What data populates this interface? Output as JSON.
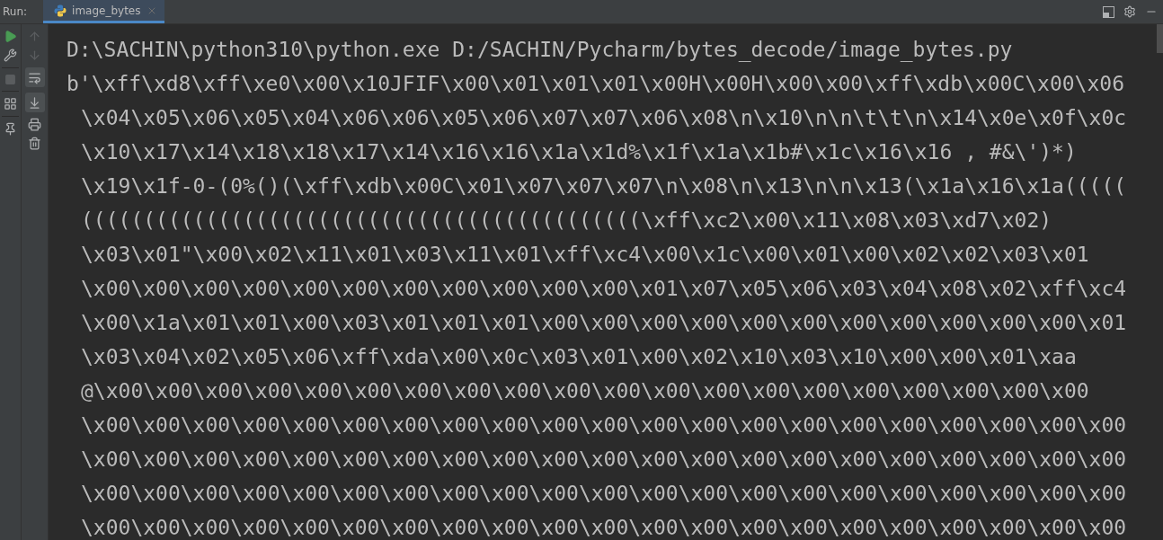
{
  "toolwindow": {
    "label": "Run:",
    "tab": {
      "title": "image_bytes",
      "selected": true
    }
  },
  "console": {
    "lines": [
      {
        "text": "D:\\SACHIN\\python310\\python.exe D:/SACHIN/Pycharm/bytes_decode/image_bytes.py",
        "continuation": false
      },
      {
        "text": "b'\\xff\\xd8\\xff\\xe0\\x00\\x10JFIF\\x00\\x01\\x01\\x01\\x00H\\x00H\\x00\\x00\\xff\\xdb\\x00C\\x00\\x06",
        "continuation": false
      },
      {
        "text": "\\x04\\x05\\x06\\x05\\x04\\x06\\x06\\x05\\x06\\x07\\x07\\x06\\x08\\n\\x10\\n\\n\\t\\t\\n\\x14\\x0e\\x0f\\x0c",
        "continuation": true
      },
      {
        "text": "\\x10\\x17\\x14\\x18\\x18\\x17\\x14\\x16\\x16\\x1a\\x1d%\\x1f\\x1a\\x1b#\\x1c\\x16\\x16 , #&\\')*)",
        "continuation": true
      },
      {
        "text": "\\x19\\x1f-0-(0%()(\\xff\\xdb\\x00C\\x01\\x07\\x07\\x07\\n\\x08\\n\\x13\\n\\n\\x13(\\x1a\\x16\\x1a(((((",
        "continuation": true
      },
      {
        "text": "(((((((((((((((((((((((((((((((((((((((((((((\\xff\\xc2\\x00\\x11\\x08\\x03\\xd7\\x02)",
        "continuation": true
      },
      {
        "text": "\\x03\\x01\"\\x00\\x02\\x11\\x01\\x03\\x11\\x01\\xff\\xc4\\x00\\x1c\\x00\\x01\\x00\\x02\\x02\\x03\\x01",
        "continuation": true
      },
      {
        "text": "\\x00\\x00\\x00\\x00\\x00\\x00\\x00\\x00\\x00\\x00\\x00\\x01\\x07\\x05\\x06\\x03\\x04\\x08\\x02\\xff\\xc4",
        "continuation": true
      },
      {
        "text": "\\x00\\x1a\\x01\\x01\\x00\\x03\\x01\\x01\\x01\\x00\\x00\\x00\\x00\\x00\\x00\\x00\\x00\\x00\\x00\\x00\\x01",
        "continuation": true
      },
      {
        "text": "\\x03\\x04\\x02\\x05\\x06\\xff\\xda\\x00\\x0c\\x03\\x01\\x00\\x02\\x10\\x03\\x10\\x00\\x00\\x01\\xaa",
        "continuation": true
      },
      {
        "text": "@\\x00\\x00\\x00\\x00\\x00\\x00\\x00\\x00\\x00\\x00\\x00\\x00\\x00\\x00\\x00\\x00\\x00\\x00\\x00\\x00",
        "continuation": true
      },
      {
        "text": "\\x00\\x00\\x00\\x00\\x00\\x00\\x00\\x00\\x00\\x00\\x00\\x00\\x00\\x00\\x00\\x00\\x00\\x00\\x00\\x00\\x00",
        "continuation": true
      },
      {
        "text": "\\x00\\x00\\x00\\x00\\x00\\x00\\x00\\x00\\x00\\x00\\x00\\x00\\x00\\x00\\x00\\x00\\x00\\x00\\x00\\x00\\x00",
        "continuation": true
      },
      {
        "text": "\\x00\\x00\\x00\\x00\\x00\\x00\\x00\\x00\\x00\\x00\\x00\\x00\\x00\\x00\\x00\\x00\\x00\\x00\\x00\\x00\\x00",
        "continuation": true
      },
      {
        "text": "\\x00\\x00\\x00\\x00\\x00\\x00\\x00\\x00\\x00\\x00\\x00\\x00\\x00\\x00\\x00\\x00\\x00\\x00\\x00\\x00\\x00",
        "continuation": true
      }
    ]
  }
}
